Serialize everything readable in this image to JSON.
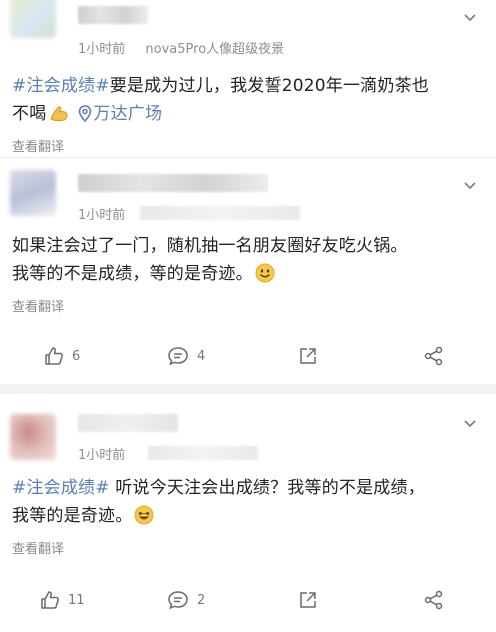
{
  "posts": [
    {
      "time": "1小时前",
      "device": "nova5Pro人像超级夜景",
      "tag": "#注会成绩#",
      "text1": "要是成为过儿，我发誓2020年一滴奶茶也",
      "text2": "不喝",
      "emoji": "flexed-bicep",
      "location": "万达广场",
      "translate": "查看翻译"
    },
    {
      "time": "1小时前",
      "text1": "如果注会过了一门，随机抽一名朋友圈好友吃火锅。",
      "text2": "我等的不是成绩，等的是奇迹。",
      "emoji": "smile",
      "translate": "查看翻译",
      "likes": "6",
      "comments": "4"
    },
    {
      "time": "1小时前",
      "tag": "#注会成绩#",
      "text1": " 听说今天注会出成绩？我等的不是成绩，",
      "text2": "我等的是奇迹。",
      "emoji": "laugh",
      "translate": "查看翻译",
      "likes": "11",
      "comments": "2"
    }
  ],
  "colors": {
    "link": "#5b7fb3",
    "meta": "#8e8e8e",
    "icon": "#6a6a6a",
    "divider": "#f2f2f2"
  }
}
